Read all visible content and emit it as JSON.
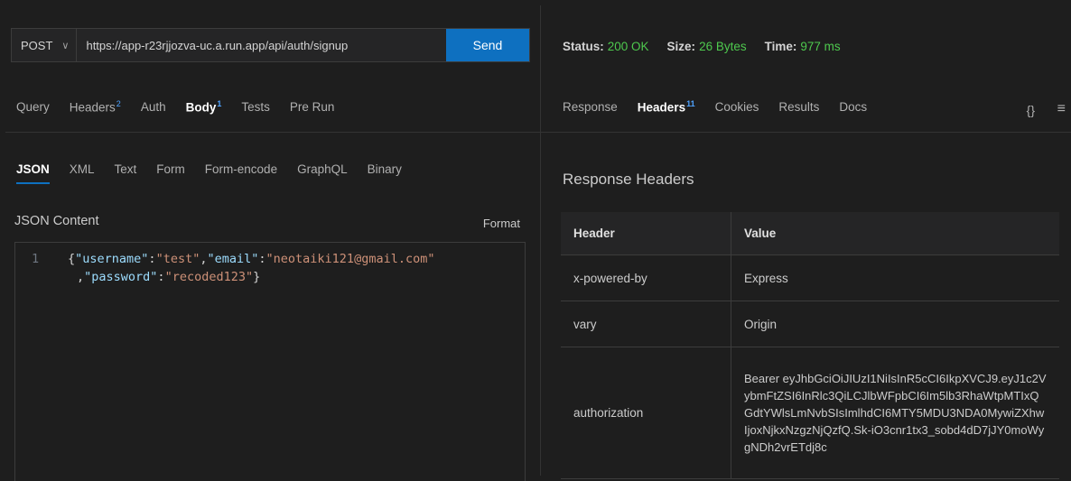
{
  "request": {
    "method": "POST",
    "url": "https://app-r23rjjozva-uc.a.run.app/api/auth/signup",
    "send_label": "Send",
    "tabs": [
      {
        "label": "Query"
      },
      {
        "label": "Headers",
        "badge": "2"
      },
      {
        "label": "Auth"
      },
      {
        "label": "Body",
        "badge": "1",
        "active": true
      },
      {
        "label": "Tests"
      },
      {
        "label": "Pre Run"
      }
    ],
    "body_tabs": [
      {
        "label": "JSON",
        "active": true
      },
      {
        "label": "XML"
      },
      {
        "label": "Text"
      },
      {
        "label": "Form"
      },
      {
        "label": "Form-encode"
      },
      {
        "label": "GraphQL"
      },
      {
        "label": "Binary"
      }
    ],
    "json_content_label": "JSON Content",
    "format_label": "Format",
    "line_number": "1",
    "code": {
      "k_username": "\"username\"",
      "v_username": "\"test\"",
      "k_email": "\"email\"",
      "v_email": "\"neotaiki121@gmail.com\"",
      "k_password": "\"password\"",
      "v_password": "\"recoded123\""
    }
  },
  "response": {
    "status_label": "Status:",
    "status_value": "200 OK",
    "size_label": "Size:",
    "size_value": "26 Bytes",
    "time_label": "Time:",
    "time_value": "977 ms",
    "tabs": [
      {
        "label": "Response"
      },
      {
        "label": "Headers",
        "badge": "11",
        "active": true
      },
      {
        "label": "Cookies"
      },
      {
        "label": "Results"
      },
      {
        "label": "Docs"
      }
    ],
    "section_title": "Response Headers",
    "columns": [
      "Header",
      "Value"
    ],
    "rows": [
      {
        "header": "x-powered-by",
        "value": "Express"
      },
      {
        "header": "vary",
        "value": "Origin"
      },
      {
        "header": "authorization",
        "value": "Bearer eyJhbGciOiJIUzI1NiIsInR5cCI6IkpXVCJ9.eyJ1c2VybmFtZSI6InRlc3QiLCJlbWFpbCI6Im5lb3RhaWtpMTIxQGdtYWlsLmNvbSIsImlhdCI6MTY5MDU3NDA0MywiZXhwIjoxNjkxNzgzNjQzfQ.Sk-iO3cnr1tx3_sobd4dD7jJY0moWygNDh2vrETdj8c"
      }
    ]
  },
  "icons": {
    "method_dropdown": "chevron-down-icon",
    "braces": "braces-icon",
    "menu": "menu-icon"
  }
}
